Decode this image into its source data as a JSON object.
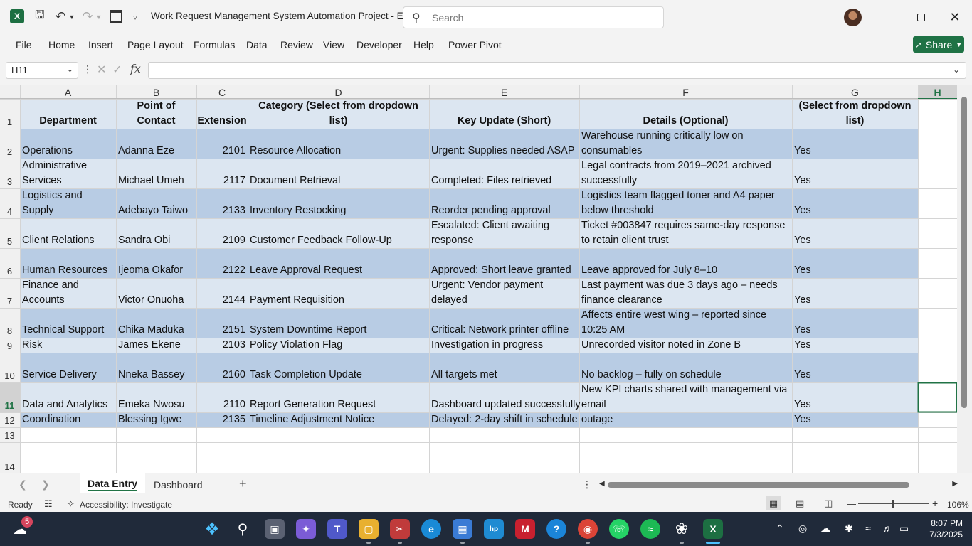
{
  "titlebar": {
    "app_icon_letter": "X",
    "doc_title": "Work Request Management System Automation Project  -  E...",
    "search_placeholder": "Search"
  },
  "ribbon_tabs": [
    "File",
    "Home",
    "Insert",
    "Page Layout",
    "Formulas",
    "Data",
    "Review",
    "View",
    "Developer",
    "Help",
    "Power Pivot"
  ],
  "share_label": "Share",
  "formula_bar": {
    "name_box": "H11",
    "fx_label": "fx",
    "formula": ""
  },
  "columns": [
    "A",
    "B",
    "C",
    "D",
    "E",
    "F",
    "G",
    "H"
  ],
  "row_numbers": [
    "1",
    "2",
    "3",
    "4",
    "5",
    "6",
    "7",
    "8",
    "9",
    "10",
    "11",
    "12",
    "13",
    "14"
  ],
  "headers": [
    "Department",
    "Point of Contact",
    "Extension",
    "Category (Select from dropdown list)",
    "Key Update (Short)",
    "Details (Optional)",
    "Applies to Today? (Select from dropdown list)"
  ],
  "rows": [
    [
      "Operations",
      "Adanna Eze",
      "2101",
      "Resource Allocation",
      "Urgent: Supplies needed ASAP",
      "Warehouse running critically low on consumables",
      "Yes"
    ],
    [
      "Administrative Services",
      "Michael Umeh",
      "2117",
      "Document Retrieval",
      "Completed: Files retrieved",
      "Legal contracts from 2019–2021 archived successfully",
      "Yes"
    ],
    [
      "Logistics and Supply",
      "Adebayo Taiwo",
      "2133",
      "Inventory Restocking",
      "Reorder pending approval",
      "Logistics team flagged toner and A4 paper below threshold",
      "Yes"
    ],
    [
      "Client Relations",
      "Sandra Obi",
      "2109",
      "Customer Feedback Follow-Up",
      "Escalated: Client awaiting response",
      "Ticket #003847 requires same-day response to retain client trust",
      "Yes"
    ],
    [
      "Human Resources",
      "Ijeoma Okafor",
      "2122",
      "Leave Approval Request",
      "Approved: Short leave granted",
      "Leave approved for July 8–10",
      "Yes"
    ],
    [
      "Finance and Accounts",
      "Victor Onuoha",
      "2144",
      "Payment Requisition",
      "Urgent: Vendor payment delayed",
      "Last payment was due 3 days ago – needs finance clearance",
      "Yes"
    ],
    [
      "Technical Support",
      "Chika Maduka",
      "2151",
      "System Downtime Report",
      "Critical: Network printer offline",
      "Affects entire west wing – reported since 10:25 AM",
      "Yes"
    ],
    [
      "Compliance and Risk",
      "James Ekene",
      "2103",
      "Policy Violation Flag",
      "Investigation in progress",
      "Unrecorded visitor noted in Zone B",
      "Yes"
    ],
    [
      "Service Delivery",
      "Nneka Bassey",
      "2160",
      "Task Completion Update",
      "All targets met",
      "No backlog – fully on schedule",
      "Yes"
    ],
    [
      "Data and Analytics",
      "Emeka Nwosu",
      "2110",
      "Report Generation Request",
      "Dashboard updated successfully",
      "New KPI charts shared with management via email",
      "Yes"
    ],
    [
      "Project Coordination",
      "Blessing Igwe",
      "2135",
      "Timeline Adjustment Notice",
      "Delayed: 2-day shift in schedule",
      "Testing rescheduled due to unexpected outage",
      "Yes"
    ]
  ],
  "sheet_tabs": [
    "Data Entry",
    "Dashboard"
  ],
  "status": {
    "ready": "Ready",
    "accessibility": "Accessibility: Investigate",
    "zoom": "106%"
  },
  "taskbar": {
    "weather_badge": "5",
    "time": "8:07 PM",
    "date": "7/3/2025"
  },
  "colors": {
    "header_fill": "#dce6f1",
    "band_dark": "#b8cce4",
    "band_light": "#dce6f1",
    "excel_green": "#1f7245"
  }
}
